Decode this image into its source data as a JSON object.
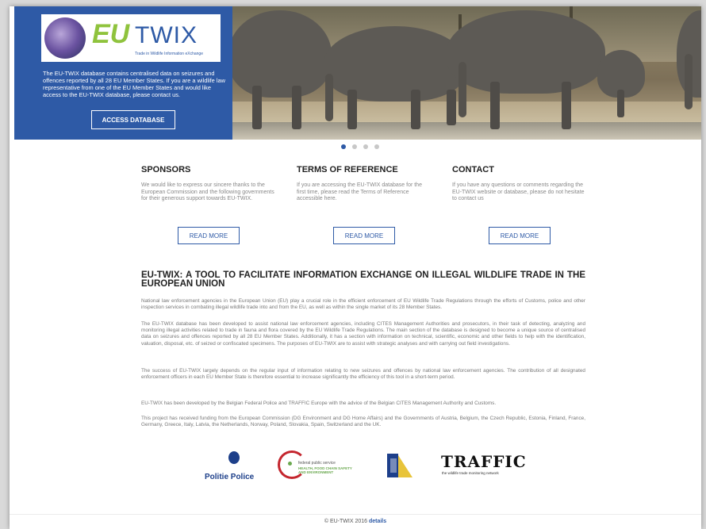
{
  "hero": {
    "logo_brand_eu": "EU",
    "logo_brand_twix": "TWIX",
    "logo_tagline": "Trade in Wildlife Information eXchange",
    "description": "The EU-TWIX database contains centralised data on seizures and offences reported by all 28 EU Member States. If you are a wildlife law representative from one of the EU Member States and would like access to the EU-TWIX database, please contact us.",
    "access_button": "ACCESS DATABASE"
  },
  "carousel": {
    "slides": 4,
    "active": 1
  },
  "columns": [
    {
      "title": "SPONSORS",
      "text": "We would like to express our sincere thanks to the European Commission and the following governments for their generous support towards EU-TWIX.",
      "button": "READ MORE"
    },
    {
      "title": "TERMS OF REFERENCE",
      "text": "If you are accessing the EU-TWIX database for the first time, please read the Terms of Reference accessible here.",
      "button": "READ MORE"
    },
    {
      "title": "CONTACT",
      "text": "If you have any questions or comments regarding the EU-TWIX website or database, please do not hesitate to contact us",
      "button": "READ MORE"
    }
  ],
  "main": {
    "title": "EU-TWIX: A TOOL TO FACILITATE INFORMATION EXCHANGE ON ILLEGAL WILDLIFE TRADE IN THE EUROPEAN UNION",
    "paragraphs": [
      "National law enforcement agencies in the European Union (EU) play a crucial role in the efficient enforcement of EU Wildlife Trade Regulations through the efforts of Customs, police and other inspection services in combating illegal wildlife trade into and from the EU, as well as within the single market of its 28 Member States.",
      "The EU-TWIX database has been developed to assist national law enforcement agencies, including CITES Management Authorities and prosecutors, in their task of detecting, analyzing and monitoring illegal activities related to trade in fauna and flora covered by the EU Wildlife Trade Regulations. The main section of the database is designed to become a unique source of centralised data on seizures and offences reported by all 28 EU Member States. Additionally, it has a section with information on technical, scientific, economic and other fields to help with the identification, valuation, disposal, etc. of seized or confiscated specimens. The purposes of EU-TWIX are to assist with strategic analyses and with carrying out field investigations.",
      "The success of EU-TWIX largely depends on the regular input of information relating to new seizures and offences by national law enforcement agencies. The contribution of all designated enforcement officers in each EU Member State is therefore essential to increase significantly the efficiency of this tool in a short-term period.",
      "EU-TWIX has been developed by the Belgian Federal Police and TRAFFIC Europe with the advice of the Belgian CITES Management Authority and Customs.",
      "This project has received funding from the European Commission (DG Environment and DG Home Affairs) and the Governments of Austria, Belgium, the Czech Republic, Estonia, Finland, France, Germany, Greece, Italy, Latvia, the Netherlands, Norway, Poland, Slovakia, Spain, Switzerland and the UK."
    ]
  },
  "partners": {
    "police": "Politie Police",
    "fps_line1": "federal public service",
    "fps_line2": "HEALTH, FOOD CHAIN SAFETY AND ENVIRONMENT",
    "traffic": "TRAFFIC",
    "traffic_tag": "the wildlife trade monitoring network"
  },
  "footer": {
    "copyright": "© EU-TWIX 2016",
    "link": "details"
  },
  "colors": {
    "brand_blue": "#2e5aa6",
    "brand_green": "#8fc33d"
  }
}
